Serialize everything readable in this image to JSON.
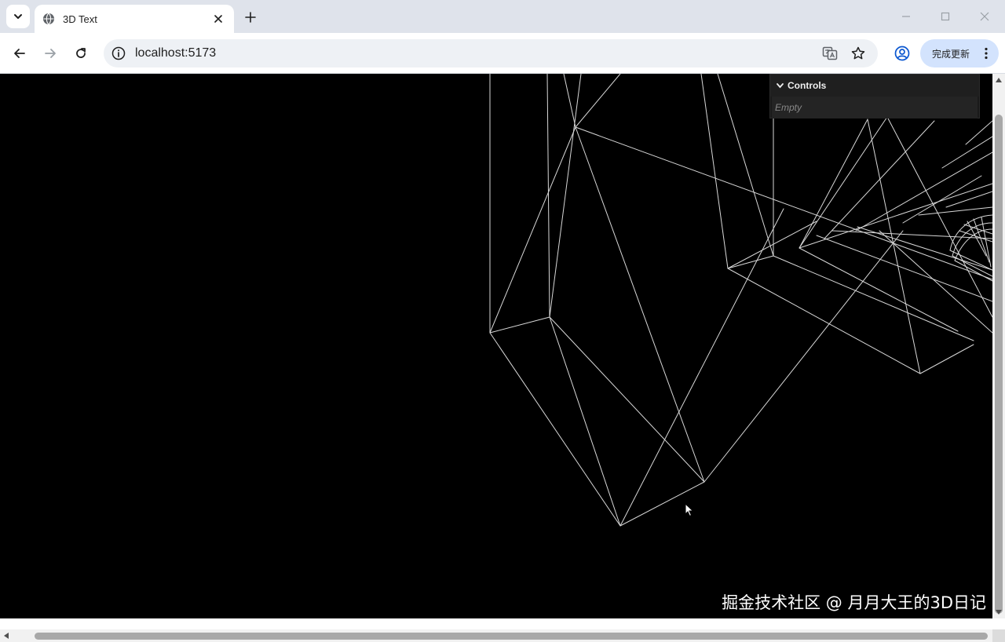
{
  "browser": {
    "tab": {
      "title": "3D Text",
      "favicon": "globe-icon"
    },
    "address": {
      "url": "localhost:5173"
    },
    "update_button": {
      "label": "完成更新"
    },
    "colors": {
      "tabstrip": "#dfe3eb",
      "omnibox": "#eef1f5",
      "update_pill": "#d3e3fd"
    }
  },
  "gui": {
    "folder_title": "Controls",
    "empty_text": "Empty"
  },
  "watermark": "掘金技术社区 @ 月月大王的3D日记",
  "scene": {
    "background": "#000000",
    "wire_color": "#d8d8d8"
  }
}
